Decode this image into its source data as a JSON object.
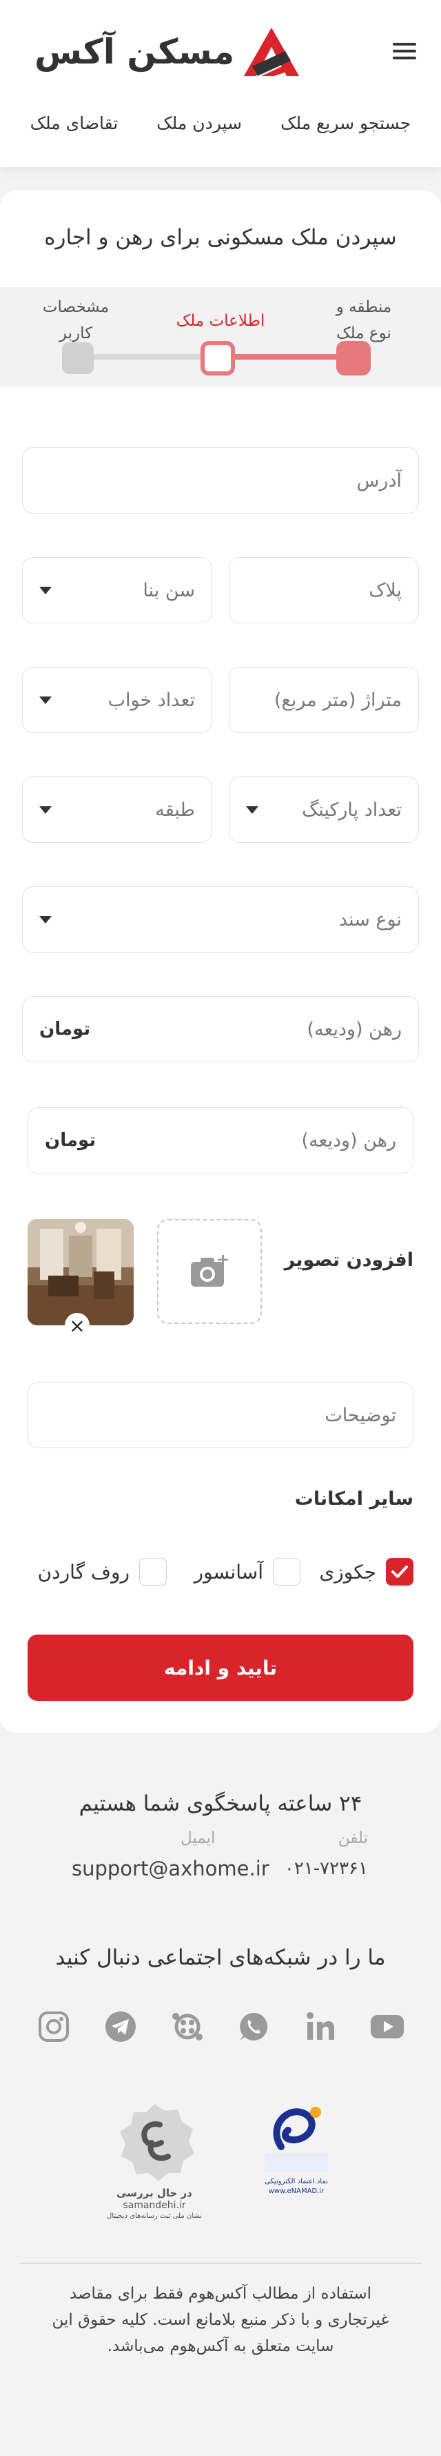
{
  "header": {
    "brand": "مسکن آکس",
    "nav": [
      "جستجو سریع ملک",
      "سپردن ملک",
      "تقاضای ملک"
    ]
  },
  "form": {
    "title": "سپردن ملک مسکونی برای رهن و اجاره",
    "steps": [
      {
        "label_line1": "منطقه و",
        "label_line2": "نوع ملک",
        "state": "done"
      },
      {
        "label_line1": "اطلاعات ملک",
        "label_line2": "",
        "state": "active"
      },
      {
        "label_line1": "مشخصات",
        "label_line2": "کاربر",
        "state": "pending"
      }
    ],
    "progress_fraction": 0.5,
    "address_placeholder": "آدرس",
    "plaque_placeholder": "پلاک",
    "building_age_placeholder": "سن بنا",
    "area_placeholder": "متراژ (متر مربع)",
    "bedrooms_placeholder": "تعداد خواب",
    "parking_placeholder": "تعداد پارکینگ",
    "floor_placeholder": "طبقه",
    "document_type_placeholder": "نوع سند",
    "deposit_placeholder": "رهن (ودیعه)",
    "deposit_unit": "تومان",
    "deposit2_placeholder": "رهن (ودیعه)",
    "deposit2_unit": "تومان",
    "add_image_label": "افزودن تصویر",
    "remove_image_symbol": "×",
    "description_placeholder": "توضیحات",
    "amenities_title": "سایر امکانات",
    "amenities": [
      {
        "label": "جکوزی",
        "checked": true
      },
      {
        "label": "آسانسور",
        "checked": false
      },
      {
        "label": "روف گاردن",
        "checked": false
      }
    ],
    "submit_label": "تایید و ادامه"
  },
  "footer": {
    "support_title": "۲۴ ساعته پاسخگوی شما هستیم",
    "phone_label": "تلفن",
    "phone_value": "۰۲۱-۷۲۳۶۱",
    "email_label": "ایمیل",
    "email_value": "support@axhome.ir",
    "social_title": "ما را در شبکه‌های اجتماعی دنبال کنید",
    "social_icons": [
      "youtube-icon",
      "linkedin-icon",
      "whatsapp-icon",
      "aparat-icon",
      "telegram-icon",
      "instagram-icon"
    ],
    "enamad_line1": "نماد اعتماد الکترونیکی",
    "enamad_line2": "www.eNAMAD.ir",
    "samandehi_status": "در حال بررسی",
    "samandehi_site": "samandehi.ir",
    "samandehi_caption": "نشان ملی ثبت رسانه‌های دیجیتال",
    "copyright_line1": "استفاده از مطالب آکس‌هوم فقط برای مقاصد",
    "copyright_line2": "غیرتجاری و با ذکر منبع بلامانع است. کلیه حقوق این",
    "copyright_line3": "سایت متعلق  به آکس‌هوم می‌باشد."
  },
  "colors": {
    "accent": "#d9242c",
    "accent_soft": "#e8787c",
    "text": "#333333",
    "page_bg": "#f3f3f4"
  }
}
